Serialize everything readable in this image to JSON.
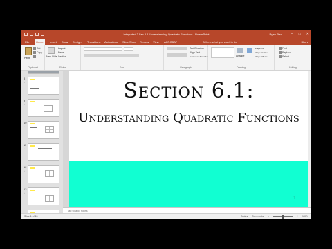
{
  "window": {
    "title": "Integrated 3 Sec 6.1 Understanding Quadratic Functions - PowerPoint",
    "user": "Ryan Pied",
    "controls": [
      "–",
      "□",
      "✕"
    ]
  },
  "tabs": {
    "items": [
      "File",
      "Home",
      "Insert",
      "Draw",
      "Design",
      "Transitions",
      "Animations",
      "Slide Show",
      "Review",
      "View",
      "ACROBAT"
    ],
    "active_index": 1,
    "tell_me": "Tell me what you want to do",
    "share": "Share"
  },
  "ribbon": {
    "clipboard": {
      "paste": "Paste",
      "cut": "Cut",
      "copy": "Copy",
      "format_painter": "Format Painter",
      "label": "Clipboard"
    },
    "slides": {
      "new_slide": "New Slide",
      "layout": "Layout",
      "reset": "Reset",
      "section": "Section",
      "label": "Slides"
    },
    "font": {
      "label": "Font"
    },
    "paragraph": {
      "text_direction": "Text Direction",
      "align_text": "Align Text",
      "convert": "Convert to SmartArt",
      "label": "Paragraph"
    },
    "drawing": {
      "arrange": "Arrange",
      "quick_styles": "Quick Styles",
      "shape_fill": "Shape Fill",
      "shape_outline": "Shape Outline",
      "shape_effects": "Shape Effects",
      "label": "Drawing"
    },
    "editing": {
      "find": "Find",
      "replace": "Replace",
      "select": "Select",
      "label": "Editing"
    }
  },
  "slide_pane": {
    "numbers": [
      "8",
      "9",
      "10",
      "11",
      "12",
      "13"
    ]
  },
  "slide": {
    "title": "Section 6.1:",
    "subtitle": "Understanding Quadratic Functions",
    "number": "1"
  },
  "notes": {
    "placeholder": "Tap to add notes"
  },
  "status": {
    "left": "Slide 1 of 13",
    "notes": "Notes",
    "comments": "Comments",
    "zoom": "100%"
  }
}
